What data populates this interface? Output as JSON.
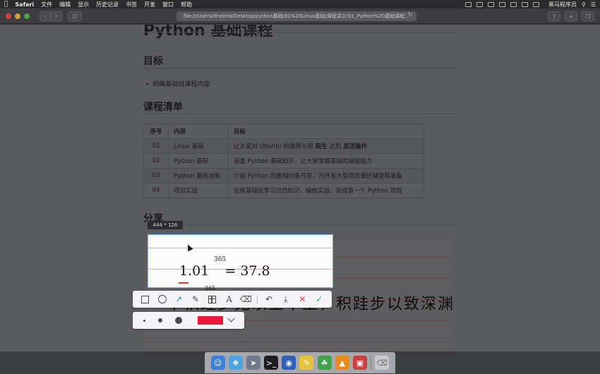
{
  "menubar": {
    "app_name": "Safari",
    "items": [
      "文件",
      "编辑",
      "显示",
      "历史记录",
      "书签",
      "开发",
      "窗口",
      "帮助"
    ],
    "user": "黑马程序员"
  },
  "browser": {
    "address": "file:///Users/itheima/Desktop/python基础/01%20Linux基础/课程讲义/01_Python%20基础课程..."
  },
  "document": {
    "title_partial": "Python 基础课程",
    "section_goal": "目标",
    "goal_item": "明确基础班课程内容",
    "section_list": "课程清单",
    "table_headers": [
      "序号",
      "内容",
      "目标"
    ],
    "rows": [
      {
        "num": "01",
        "content": "Linux 基础",
        "goal_a": "让大家对 Ubuntu 的使用从很 ",
        "goal_b": "陌生",
        "goal_c": " 达到 ",
        "goal_d": "灵活操作"
      },
      {
        "num": "02",
        "content": "Python 基础",
        "goal": "涵盖 Python 基础知识，让大家掌握基础的编程能力"
      },
      {
        "num": "03",
        "content": "Python 面向对象",
        "goal": "介绍 Python 的面相对象开发，为开发大型项目做好铺垫和准备"
      },
      {
        "num": "04",
        "content": "项目实战",
        "goal": "应用基础班学习过的知识，编程实战，完成第一个 Python 项目"
      }
    ],
    "section_share": "分享",
    "image_formula": "1.01",
    "image_exponent": "365",
    "image_result": "= 37.8",
    "image_exponent_below": "365",
    "image_handwriting": "不积跬步无以至千里，积跬步以致深渊"
  },
  "capture": {
    "size_label": "444 * 126",
    "tools": [
      "rectangle-tool",
      "ellipse-tool",
      "arrow-tool",
      "pen-tool",
      "mosaic-tool",
      "text-tool",
      "eraser-tool",
      "undo",
      "download",
      "cancel",
      "confirm"
    ],
    "colors": {
      "selection_border": "#7ab6e8",
      "active_tool": "#1f8fd8",
      "cancel": "#e04141",
      "confirm": "#33b26a",
      "selected_color": "#e8193c"
    }
  }
}
